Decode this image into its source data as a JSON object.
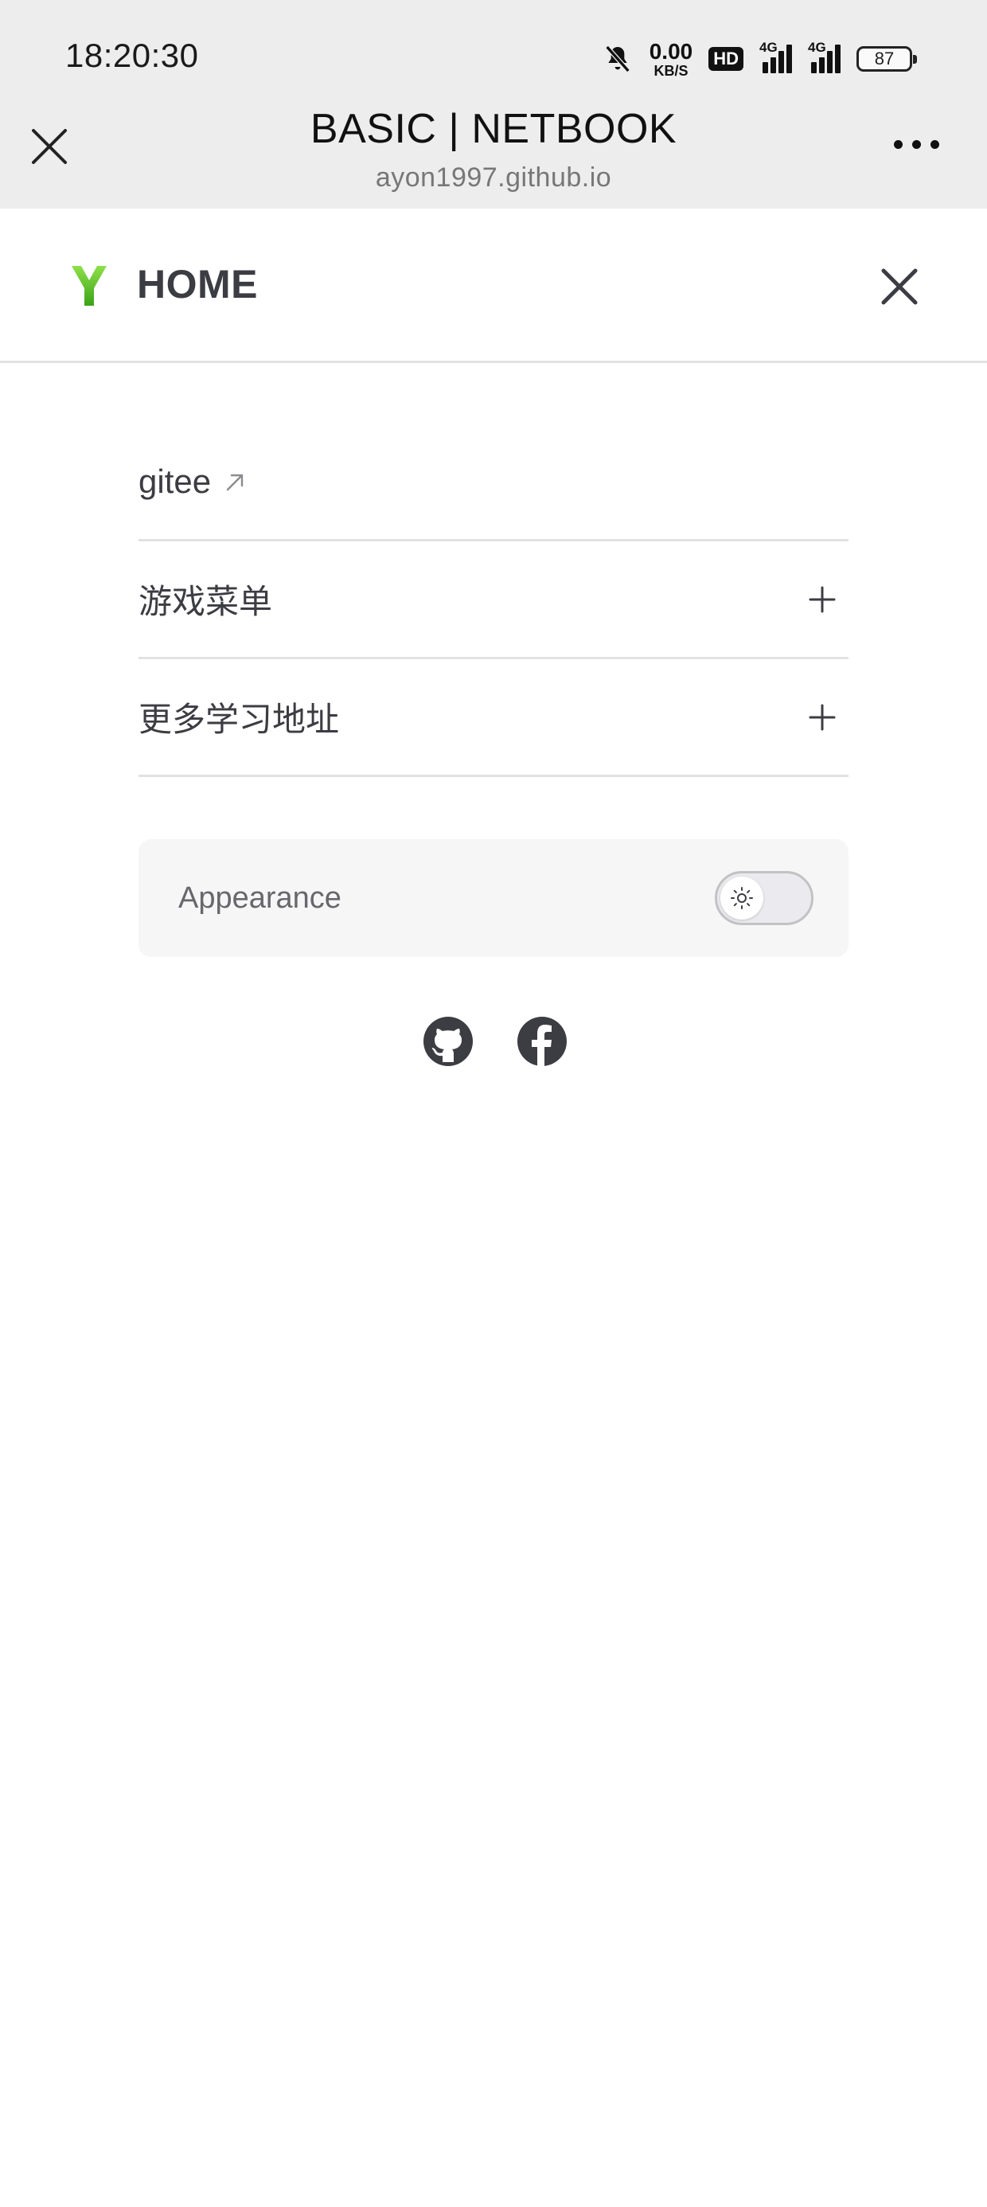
{
  "status_bar": {
    "time": "18:20:30",
    "net_speed_value": "0.00",
    "net_speed_unit": "KB/S",
    "hd_badge": "HD",
    "signal1_label": "4G",
    "signal2_label": "4G",
    "battery_level": "87"
  },
  "browser": {
    "page_title": "BASIC | NETBOOK",
    "url": "ayon1997.github.io"
  },
  "nav": {
    "title": "HOME",
    "logo_color": "#52c41a"
  },
  "menu": {
    "items": [
      {
        "label": "gitee",
        "icon": "external-link-icon"
      },
      {
        "label": "游戏菜单",
        "icon": "plus-icon"
      },
      {
        "label": "更多学习地址",
        "icon": "plus-icon"
      }
    ]
  },
  "appearance": {
    "label": "Appearance",
    "mode": "light",
    "toggle_icon": "sun-icon"
  },
  "social": {
    "links": [
      "github-icon",
      "facebook-icon"
    ]
  }
}
